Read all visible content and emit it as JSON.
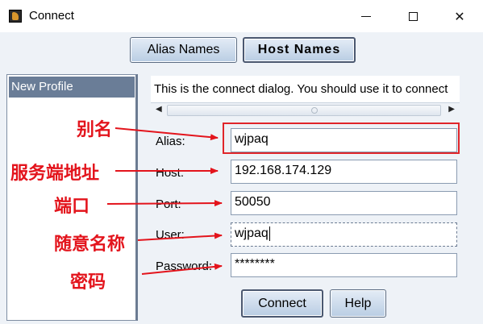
{
  "window": {
    "title": "Connect",
    "icon": "app-icon",
    "controls": [
      "minimize-icon",
      "maximize-icon",
      "close-icon"
    ],
    "close_symbol": "✕"
  },
  "tabs": {
    "alias_names": "Alias Names",
    "host_names": "Host Names"
  },
  "profiles": {
    "items": [
      "New Profile"
    ]
  },
  "description": {
    "text": "This is the connect dialog. You should use it to connect"
  },
  "form": {
    "alias_label": "Alias:",
    "alias_value": "wjpaq",
    "host_label": "Host:",
    "host_value": "192.168.174.129",
    "port_label": "Port:",
    "port_value": "50050",
    "user_label": "User:",
    "user_value": "wjpaq",
    "password_label": "Password:",
    "password_value": "********"
  },
  "buttons": {
    "connect": "Connect",
    "help": "Help"
  },
  "annotations": {
    "alias": "别名",
    "host": "服务端地址",
    "port": "端口",
    "user": "随意名称",
    "password": "密码",
    "color": "#e3141c"
  }
}
